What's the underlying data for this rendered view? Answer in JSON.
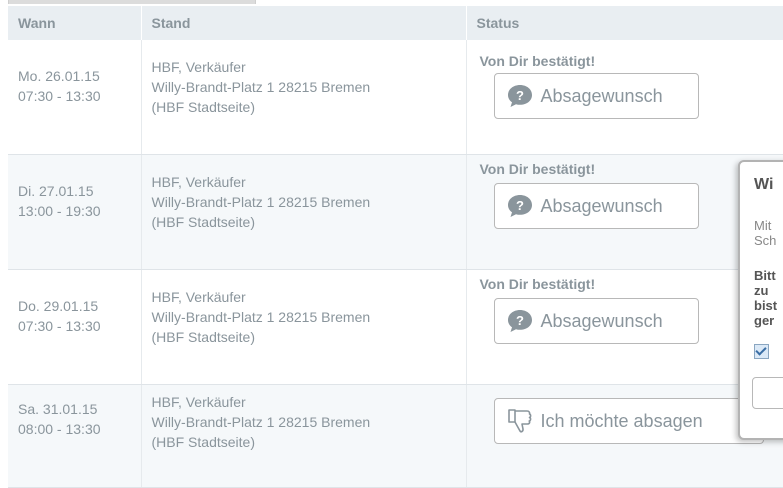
{
  "table": {
    "headers": {
      "wann": "Wann",
      "stand": "Stand",
      "status": "Status"
    },
    "rows": [
      {
        "day": "Mo. 26.01.15",
        "time": "07:30 - 13:30",
        "stand_name": "HBF, Verkäufer",
        "stand_address": "Willy-Brandt-Platz 1 28215 Bremen",
        "stand_note": "(HBF Stadtseite)",
        "status_text": "Von Dir bestätigt!",
        "button_label": "Absagewunsch"
      },
      {
        "day": "Di. 27.01.15",
        "time": "13:00 - 19:30",
        "stand_name": "HBF, Verkäufer",
        "stand_address": "Willy-Brandt-Platz 1 28215 Bremen",
        "stand_note": "(HBF Stadtseite)",
        "status_text": "Von Dir bestätigt!",
        "button_label": "Absagewunsch"
      },
      {
        "day": "Do. 29.01.15",
        "time": "07:30 - 13:30",
        "stand_name": "HBF, Verkäufer",
        "stand_address": "Willy-Brandt-Platz 1 28215 Bremen",
        "stand_note": "(HBF Stadtseite)",
        "status_text": "Von Dir bestätigt!",
        "button_label": "Absagewunsch"
      },
      {
        "day": "Sa. 31.01.15",
        "time": "08:00 - 13:30",
        "stand_name": "HBF, Verkäufer",
        "stand_address": "Willy-Brandt-Platz 1 28215 Bremen",
        "stand_note": "(HBF Stadtseite)",
        "status_text": "",
        "button_label": "Ich möchte absagen"
      }
    ]
  },
  "dialog": {
    "title": "Wi",
    "text_lines": [
      "Mit",
      "Sch"
    ],
    "bold_lines": [
      "Bitt",
      "zu",
      "bist",
      "ger"
    ]
  },
  "icons": {
    "question": "question-bubble-icon",
    "thumbs_down": "thumbs-down-icon",
    "checkbox": "checkbox-icon"
  },
  "colors": {
    "header_bg": "#e9eef2",
    "text_gray": "#8a959c",
    "row_alt_bg": "#f5f8fa"
  }
}
